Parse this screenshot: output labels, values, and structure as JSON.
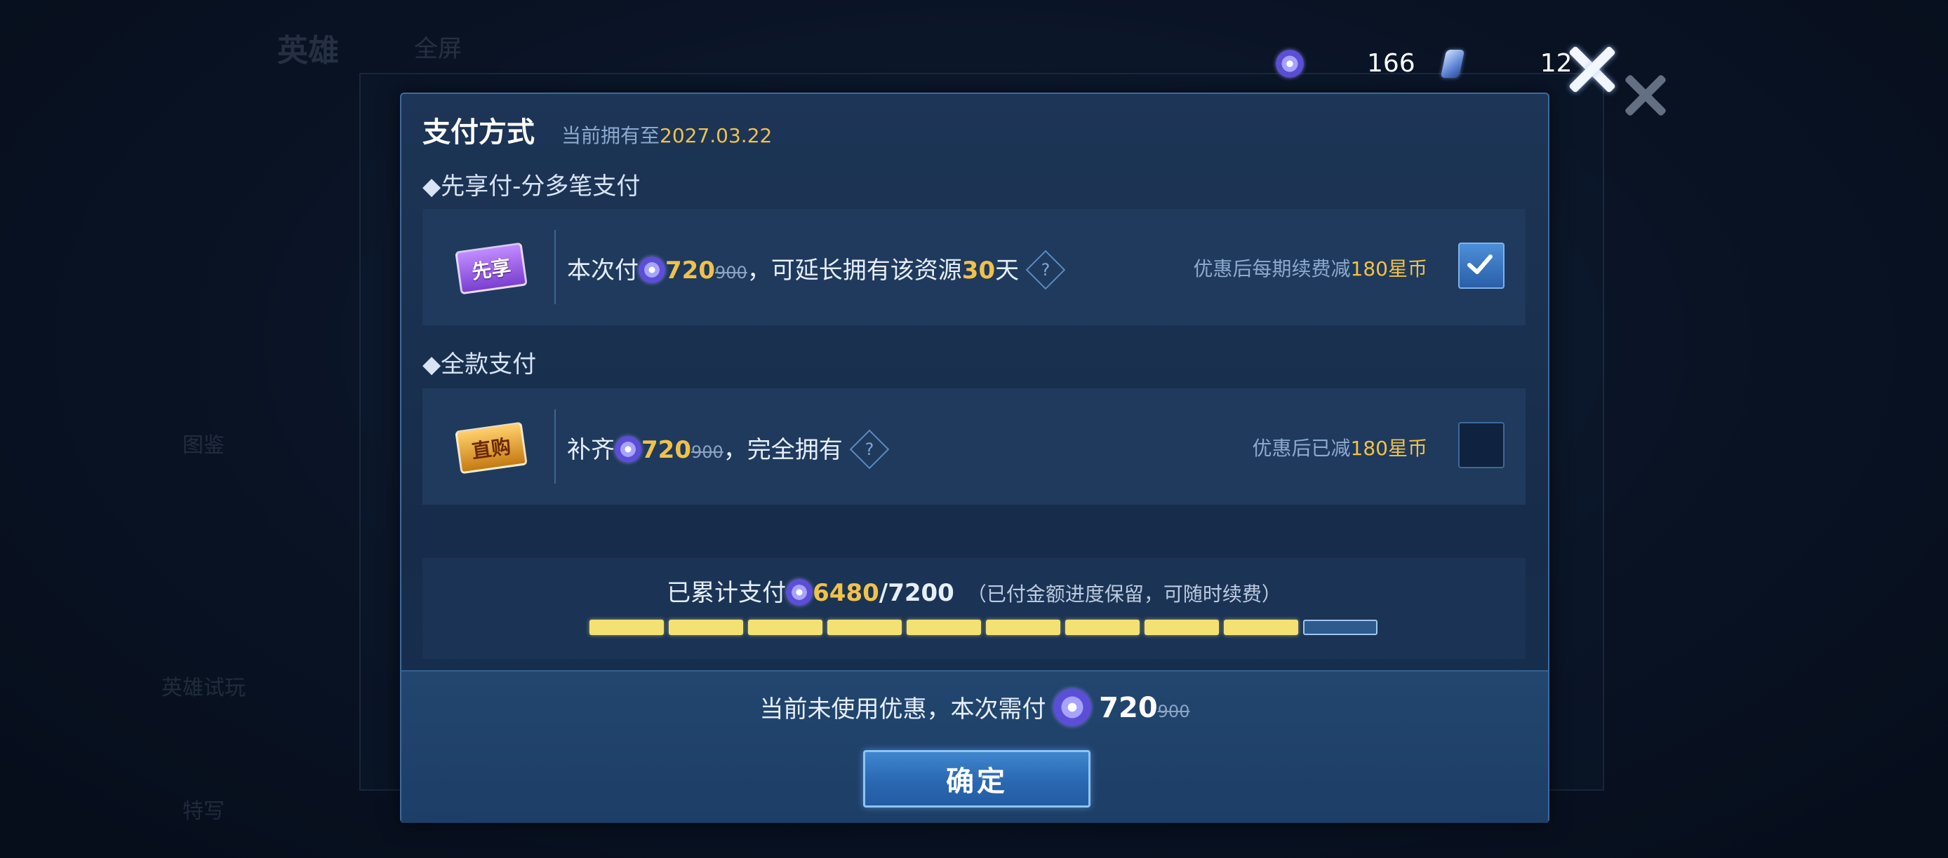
{
  "currency": {
    "coupon_value": "166",
    "ticket_value": "12"
  },
  "background": {
    "hero_tab": "英雄",
    "all_tab": "全屏",
    "side_items": [
      "图鉴",
      "英雄试玩",
      "特写"
    ]
  },
  "dialog": {
    "title": "支付方式",
    "subtitle_prefix": "当前拥有至",
    "subtitle_date": "2027.03.22",
    "section1_heading": "◆先享付-分多笔支付",
    "option1": {
      "badge": "先享",
      "text_prefix": "本次付",
      "amount": "720",
      "original": "900",
      "text_mid": "，可延长拥有该资源",
      "days": "30",
      "days_unit": "天",
      "help": "?",
      "discount_prefix": "优惠后每期续费减",
      "discount_value": "180星币",
      "checked": true
    },
    "section2_heading": "◆全款支付",
    "option2": {
      "badge": "直购",
      "text_prefix": "补齐",
      "amount": "720",
      "original": "900",
      "text_suffix": "，完全拥有",
      "help": "?",
      "discount_prefix": "优惠后已减",
      "discount_value": "180星币",
      "checked": false
    },
    "progress": {
      "label": "已累计支付",
      "paid": "6480",
      "total": "/7200",
      "note": "（已付金额进度保留，可随时续费）",
      "filled_segments": 9,
      "total_segments": 10
    },
    "footer": {
      "pay_text": "当前未使用优惠，本次需付",
      "amount": "720",
      "original": "900",
      "confirm_label": "确定"
    }
  },
  "colors": {
    "accent_gold": "#f0c14b",
    "progress_fill": "#f3e173",
    "button_blue": "#2a68b2"
  }
}
